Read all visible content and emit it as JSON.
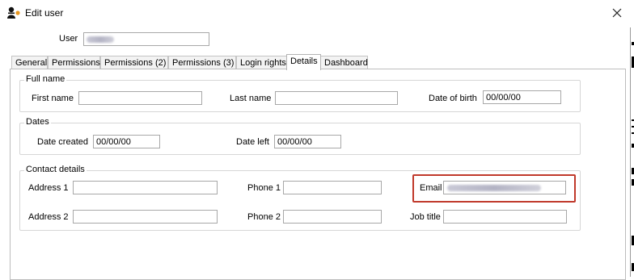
{
  "window": {
    "title": "Edit user",
    "close_icon": "close-icon",
    "app_icon": "user-app-icon"
  },
  "user": {
    "label": "User",
    "value_obscured": true
  },
  "tabs": [
    {
      "label": "General",
      "active": false
    },
    {
      "label": "Permissions",
      "active": false
    },
    {
      "label": "Permissions (2)",
      "active": false
    },
    {
      "label": "Permissions (3)",
      "active": false
    },
    {
      "label": "Login rights",
      "active": false
    },
    {
      "label": "Details",
      "active": true
    },
    {
      "label": "Dashboard",
      "active": false
    }
  ],
  "full_name": {
    "legend": "Full name",
    "first_name_label": "First name",
    "first_name_value": "",
    "last_name_label": "Last name",
    "last_name_value": "",
    "dob_label": "Date of birth",
    "dob_value": "00/00/00"
  },
  "dates": {
    "legend": "Dates",
    "created_label": "Date created",
    "created_value": "00/00/00",
    "left_label": "Date left",
    "left_value": "00/00/00"
  },
  "contact": {
    "legend": "Contact details",
    "address1_label": "Address 1",
    "address1_value": "",
    "phone1_label": "Phone 1",
    "phone1_value": "",
    "email_label": "Email",
    "email_value_obscured": true,
    "address2_label": "Address 2",
    "address2_value": "",
    "phone2_label": "Phone 2",
    "phone2_value": "",
    "job_title_label": "Job title",
    "job_title_value": ""
  },
  "colors": {
    "highlight": "#c0392b",
    "field_border": "#a8a8a8",
    "group_border": "#d6d6d6"
  }
}
